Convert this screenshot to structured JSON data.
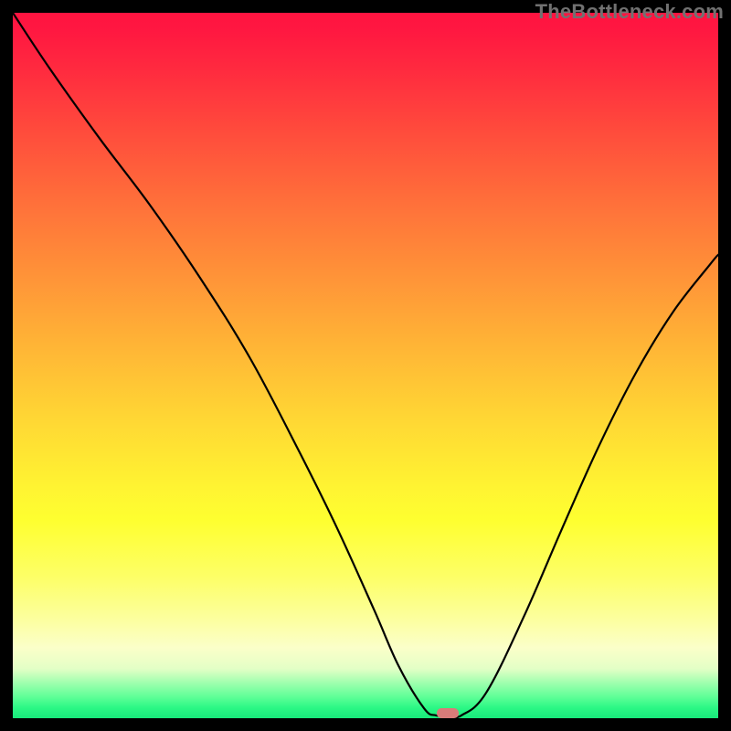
{
  "watermark": "TheBottleneck.com",
  "marker": {
    "color": "#d97b79",
    "x_frac": 0.617,
    "y_frac": 0.994
  },
  "chart_data": {
    "type": "line",
    "title": "",
    "xlabel": "",
    "ylabel": "",
    "xlim": [
      0,
      1
    ],
    "ylim": [
      0,
      1
    ],
    "grid": false,
    "legend": false,
    "notes": "Axis-less bottleneck curve. x: normalized hardware balance position (0=left, 1=right). y: bottleneck severity (1=max/red, 0=none/green). Single black curve with minimum near x≈0.62, rising steeply on both sides. Small reddish marker at the minimum.",
    "series": [
      {
        "name": "bottleneck-curve",
        "x": [
          0.0,
          0.053,
          0.123,
          0.194,
          0.265,
          0.336,
          0.406,
          0.459,
          0.512,
          0.547,
          0.583,
          0.6,
          0.618,
          0.636,
          0.671,
          0.724,
          0.777,
          0.83,
          0.883,
          0.936,
          0.989,
          1.0
        ],
        "y": [
          1.0,
          0.92,
          0.822,
          0.728,
          0.625,
          0.511,
          0.378,
          0.271,
          0.154,
          0.074,
          0.014,
          0.004,
          0.003,
          0.004,
          0.036,
          0.143,
          0.265,
          0.384,
          0.489,
          0.576,
          0.644,
          0.657
        ]
      }
    ],
    "gradient_stops": [
      {
        "pos": 0.0,
        "color": "#ff1440"
      },
      {
        "pos": 0.37,
        "color": "#ff9238"
      },
      {
        "pos": 0.67,
        "color": "#fff332"
      },
      {
        "pos": 0.95,
        "color": "#9fffae"
      },
      {
        "pos": 1.0,
        "color": "#18e97b"
      }
    ]
  }
}
